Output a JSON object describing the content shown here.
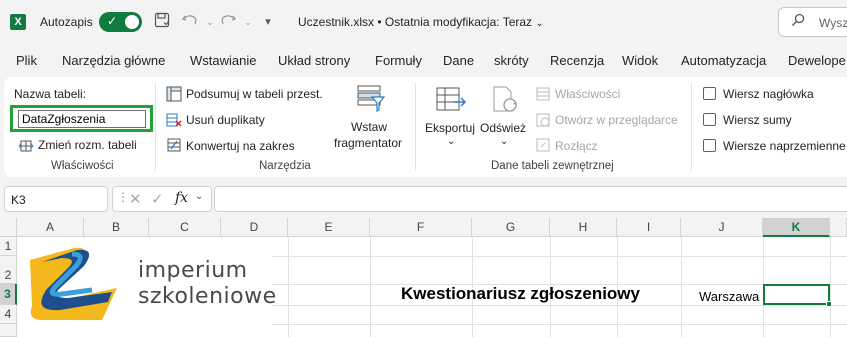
{
  "titlebar": {
    "app_logo": "X",
    "autosave_label": "Autozapis",
    "autosave_on": true,
    "file_title": "Uczestnik.xlsx • Ostatnia modyfikacja: Teraz",
    "search_placeholder": "Wysz"
  },
  "tabs": [
    "Plik",
    "Narzędzia główne",
    "Wstawianie",
    "Układ strony",
    "Formuły",
    "Dane",
    "skróty",
    "Recenzja",
    "Widok",
    "Automatyzacja",
    "Dewelope"
  ],
  "ribbon": {
    "properties": {
      "table_name_label": "Nazwa tabeli:",
      "table_name_value": "DataZgłoszenia",
      "resize_label": "Zmień rozm. tabeli",
      "group_label": "Właściwości"
    },
    "tools": {
      "summarize": "Podsumuj w tabeli przest.",
      "remove_dupes": "Usuń duplikaty",
      "convert": "Konwertuj na zakres",
      "slicer_line1": "Wstaw",
      "slicer_line2": "fragmentator",
      "group_label": "Narzędzia"
    },
    "external": {
      "export": "Eksportuj",
      "refresh": "Odśwież",
      "properties": "Właściwości",
      "open_browser": "Otwórz w przeglądarce",
      "unlink": "Rozłącz",
      "group_label": "Dane tabeli zewnętrznej"
    },
    "style_options": {
      "header_row": "Wiersz nagłówka",
      "total_row": "Wiersz sumy",
      "banded_rows": "Wiersze naprzemienne"
    }
  },
  "formula_bar": {
    "cell_ref": "K3",
    "fx": "fx",
    "value": ""
  },
  "sheet": {
    "columns": [
      "A",
      "B",
      "C",
      "D",
      "E",
      "F",
      "G",
      "H",
      "I",
      "J",
      "K"
    ],
    "rows": [
      "1",
      "2",
      "3",
      "4"
    ],
    "logo_line1": "imperium",
    "logo_line2": "szkoleniowe",
    "title": "Kwestionariusz zgłoszeniowy",
    "j3": "Warszawa",
    "selected_cell": "K3"
  },
  "colors": {
    "accent": "#107c41",
    "highlight_box": "#22a33a",
    "logo_yellow": "#f5b81c",
    "logo_blue": "#1f4e8c",
    "logo_lightblue": "#3b9fd9"
  }
}
